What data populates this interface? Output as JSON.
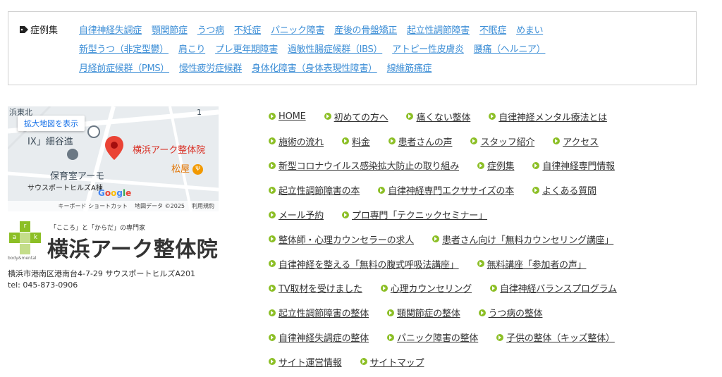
{
  "cases": {
    "heading": "症例集",
    "rows": [
      [
        "自律神経失調症",
        "顎関節症",
        "うつ病",
        "不妊症",
        "パニック障害",
        "産後の骨盤矯正",
        "起立性調節障害",
        "不眠症",
        "めまい"
      ],
      [
        "新型うつ（非定型鬱）",
        "肩こり",
        "プレ更年期障害",
        "過敏性腸症候群（IBS）",
        "アトピー性皮膚炎",
        "腰痛（ヘルニア）"
      ],
      [
        "月経前症候群（PMS）",
        "慢性疲労症候群",
        "身体化障害（身体表現性障害）",
        "線維筋痛症"
      ]
    ]
  },
  "map": {
    "enlarge_label": "拡大地図を表示",
    "place_name": "横浜アーク整体院",
    "labels": {
      "top_left": "浜東北",
      "number": "1",
      "ix": "IX」細谷進",
      "nursery": "保育室アーモ",
      "building": "サウスポートヒルズA棟",
      "matsuya": "松屋"
    },
    "google": "Google",
    "footer": [
      "キーボード ショートカット",
      "地図データ ©2025",
      "利用規約"
    ]
  },
  "logo": {
    "tagline": "「こころ」と「からだ」の専門家",
    "name": "横浜アーク整体院",
    "sub": "body&mental",
    "letters": [
      "r",
      "a",
      "k"
    ]
  },
  "address": {
    "line1": "横浜市港南区港南台4-7-29 サウスポートヒルズA201",
    "line2": "tel: 045-873-0906"
  },
  "nav": [
    [
      "HOME",
      "初めての方へ",
      "痛くない整体",
      "自律神経メンタル療法とは"
    ],
    [
      "施術の流れ",
      "料金",
      "患者さんの声",
      "スタッフ紹介",
      "アクセス"
    ],
    [
      "新型コロナウイルス感染拡大防止の取り組み",
      "症例集",
      "自律神経専門情報"
    ],
    [
      "起立性調節障害の本",
      "自律神経専門エクササイズの本",
      "よくある質問"
    ],
    [
      "メール予約",
      "プロ専門「テクニックセミナー」"
    ],
    [
      "整体師・心理カウンセラーの求人",
      "患者さん向け「無料カウンセリング講座」"
    ],
    [
      "自律神経を整える「無料の腹式呼吸法講座」",
      "無料講座「参加者の声」"
    ],
    [
      "TV取材を受けました",
      "心理カウンセリング",
      "自律神経バランスプログラム"
    ],
    [
      "起立性調節障害の整体",
      "顎関節症の整体",
      "うつ病の整体"
    ],
    [
      "自律神経失調症の整体",
      "パニック障害の整体",
      "子供の整体（キッズ整体）"
    ],
    [
      "サイト運営情報",
      "サイトマップ"
    ]
  ],
  "colors": {
    "link_blue": "#3c8ed6",
    "nav_arrow": "#8cbf26",
    "pin_red": "#d93025",
    "logo_green": "#8cbf26",
    "logo_green_light": "#c4dd8a"
  }
}
